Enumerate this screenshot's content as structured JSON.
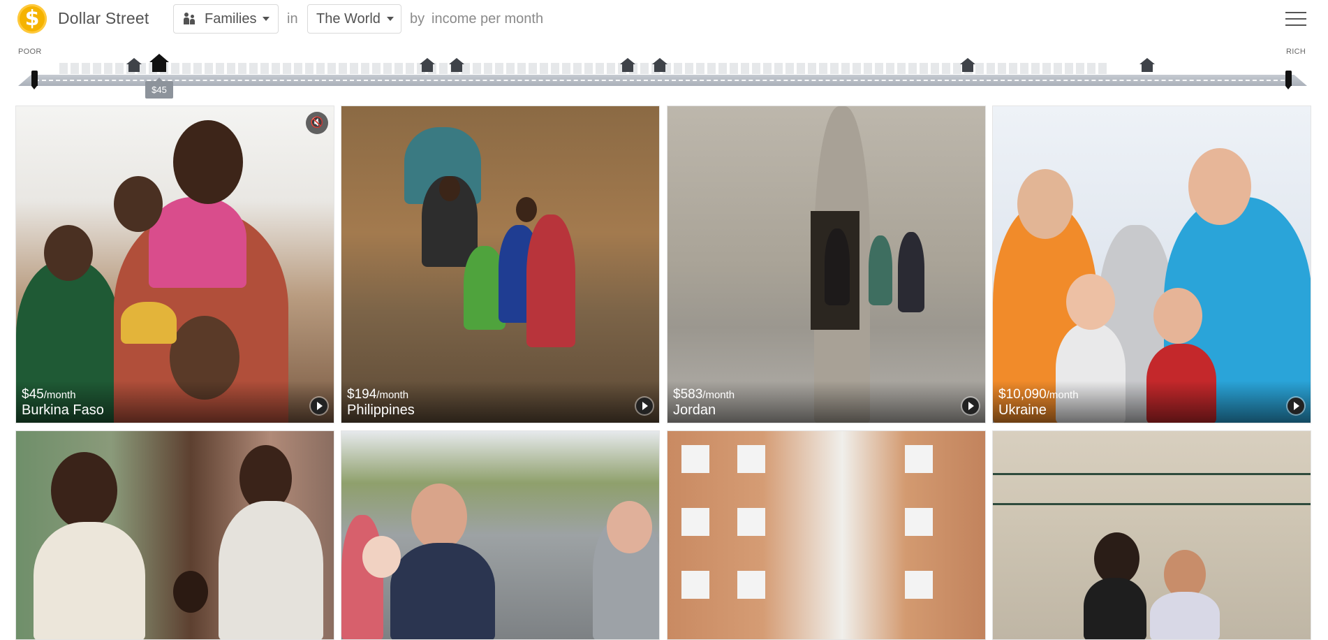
{
  "header": {
    "brand": "Dollar Street",
    "logo_symbol": "$",
    "things_label": "Families",
    "in_word": "in",
    "place_label": "The World",
    "by_word": "by",
    "income_text": "income per month"
  },
  "scale": {
    "poor_label": "POOR",
    "rich_label": "RICH",
    "selected_tooltip": "$45"
  },
  "cards": [
    {
      "income": "$45",
      "per": "/month",
      "country": "Burkina Faso"
    },
    {
      "income": "$194",
      "per": "/month",
      "country": "Philippines"
    },
    {
      "income": "$583",
      "per": "/month",
      "country": "Jordan"
    },
    {
      "income": "$10,090",
      "per": "/month",
      "country": "Ukraine"
    }
  ],
  "colors": {
    "logo": "#f5b300",
    "text": "#525252",
    "house_dark": "#3f4349"
  }
}
